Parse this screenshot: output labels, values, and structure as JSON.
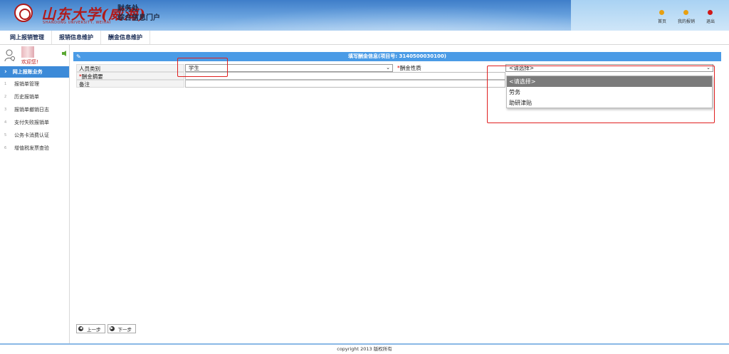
{
  "header": {
    "logo_name": "山东大学(威海)",
    "logo_sub": "SHANDONG UNIVERSITY, WEIHAI",
    "dept": "财务处",
    "portal": "综合信息门户",
    "nav": [
      {
        "label": "首页",
        "color": "#e8a010"
      },
      {
        "label": "我的报销",
        "color": "#e8a010"
      },
      {
        "label": "退出",
        "color": "#d01818"
      }
    ]
  },
  "tabs": [
    "网上报销管理",
    "报销信息维护",
    "酬金信息维护"
  ],
  "sidebar": {
    "welcome": "欢迎您!",
    "active": "网上报账业务",
    "items": [
      {
        "num": "1",
        "label": "报销单管理"
      },
      {
        "num": "2",
        "label": "历史报销单"
      },
      {
        "num": "3",
        "label": "报销单撤销日志"
      },
      {
        "num": "4",
        "label": "支付失败报销单"
      },
      {
        "num": "5",
        "label": "公务卡消费认证"
      },
      {
        "num": "6",
        "label": "增值税发票查验"
      }
    ]
  },
  "panel": {
    "title": "填写酬金信息(项目号: 3140500030100)"
  },
  "form": {
    "person_type_label": "人员类别",
    "person_type_value": "学生",
    "nature_label": "酬金性质",
    "nature_value": "<请选择>",
    "summary_label": "酬金摘要",
    "summary_value": "",
    "remark_label": "备注",
    "remark_value": "",
    "required_mark": "*"
  },
  "dropdown": {
    "options": [
      "<请选择>",
      "劳务",
      "助研津贴"
    ],
    "selected_index": 0
  },
  "buttons": {
    "prev": "上一步",
    "next": "下一步"
  },
  "footer": "copyright 2013 版权所有"
}
